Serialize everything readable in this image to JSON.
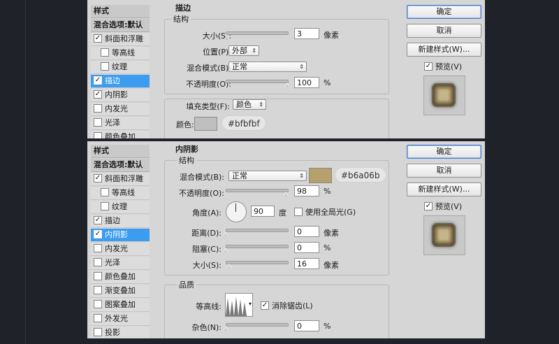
{
  "panel_top": {
    "styles_header": "样式",
    "blend_options": "混合选项:默认",
    "items": [
      {
        "label": "斜面和浮雕",
        "checked": true,
        "indent": false,
        "selected": false
      },
      {
        "label": "等高线",
        "checked": false,
        "indent": true,
        "selected": false
      },
      {
        "label": "纹理",
        "checked": false,
        "indent": true,
        "selected": false
      },
      {
        "label": "描边",
        "checked": true,
        "indent": false,
        "selected": true
      },
      {
        "label": "内阴影",
        "checked": true,
        "indent": false,
        "selected": false
      },
      {
        "label": "内发光",
        "checked": false,
        "indent": false,
        "selected": false
      },
      {
        "label": "光泽",
        "checked": false,
        "indent": false,
        "selected": false
      },
      {
        "label": "颜色叠加",
        "checked": false,
        "indent": false,
        "selected": false
      }
    ],
    "section_title": "描边",
    "group_title": "结构",
    "size_label": "大小(S):",
    "size_value": "3",
    "size_unit": "像素",
    "size_slider_fraction": 0.02,
    "position_label": "位置(P):",
    "position_value": "外部",
    "blend_label": "混合模式(B):",
    "blend_value": "正常",
    "opacity_label": "不透明度(O):",
    "opacity_value": "100",
    "opacity_unit": "%",
    "opacity_slider_fraction": 1.0,
    "fill_type_label": "填充类型(F):",
    "fill_type_value": "颜色",
    "color_label": "颜色:",
    "color_hex": "#bfbfbf",
    "color_swatch": "#bfbfbf"
  },
  "panel_bottom": {
    "styles_header": "样式",
    "blend_options": "混合选项:默认",
    "items": [
      {
        "label": "斜面和浮雕",
        "checked": true,
        "indent": false,
        "selected": false
      },
      {
        "label": "等高线",
        "checked": false,
        "indent": true,
        "selected": false
      },
      {
        "label": "纹理",
        "checked": false,
        "indent": true,
        "selected": false
      },
      {
        "label": "描边",
        "checked": true,
        "indent": false,
        "selected": false
      },
      {
        "label": "内阴影",
        "checked": true,
        "indent": false,
        "selected": true
      },
      {
        "label": "内发光",
        "checked": false,
        "indent": false,
        "selected": false
      },
      {
        "label": "光泽",
        "checked": false,
        "indent": false,
        "selected": false
      },
      {
        "label": "颜色叠加",
        "checked": false,
        "indent": false,
        "selected": false
      },
      {
        "label": "渐变叠加",
        "checked": false,
        "indent": false,
        "selected": false
      },
      {
        "label": "图案叠加",
        "checked": false,
        "indent": false,
        "selected": false
      },
      {
        "label": "外发光",
        "checked": false,
        "indent": false,
        "selected": false
      },
      {
        "label": "投影",
        "checked": false,
        "indent": false,
        "selected": false
      }
    ],
    "section_title": "内阴影",
    "group_title": "结构",
    "blend_label": "混合模式(B):",
    "blend_value": "正常",
    "color_hex": "#b6a06b",
    "color_swatch": "#b6a06b",
    "opacity_label": "不透明度(O):",
    "opacity_value": "98",
    "opacity_unit": "%",
    "opacity_slider_fraction": 0.98,
    "angle_label": "角度(A):",
    "angle_value": "90",
    "angle_unit": "度",
    "global_light_label": "使用全局光(G)",
    "global_light_checked": false,
    "distance_label": "距离(D):",
    "distance_value": "0",
    "distance_unit": "像素",
    "distance_slider_fraction": 0.0,
    "choke_label": "阻塞(C):",
    "choke_value": "0",
    "choke_unit": "%",
    "choke_slider_fraction": 0.0,
    "size_label": "大小(S):",
    "size_value": "16",
    "size_unit": "像素",
    "size_slider_fraction": 0.06,
    "quality_title": "品质",
    "contour_label": "等高线:",
    "antialias_label": "消除锯齿(L)",
    "antialias_checked": true,
    "noise_label": "杂色(N):",
    "noise_value": "0",
    "noise_unit": "%",
    "noise_slider_fraction": 0.0
  },
  "buttons": {
    "ok": "确定",
    "cancel": "取消",
    "new_style": "新建样式(W)...",
    "preview_label": "预览(V)",
    "preview_checked": true
  },
  "colors": {
    "selection": "#3b9cf0",
    "panel_bg": "#d6d6d6",
    "backdrop": "#1f2329"
  }
}
